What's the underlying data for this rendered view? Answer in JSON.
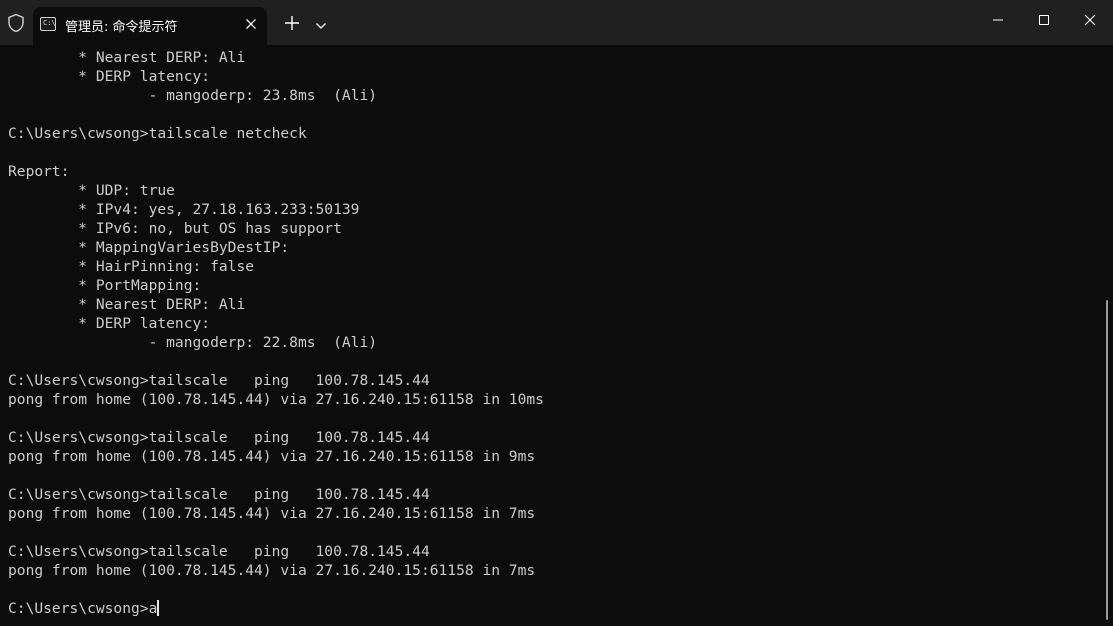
{
  "tab": {
    "title": "管理员: 命令提示符",
    "icon": "cmd-icon"
  },
  "titlebar": {
    "icons": [
      "shield-icon",
      "close-icon",
      "plus-icon",
      "chevron-down-icon",
      "minimize-icon",
      "maximize-icon",
      "close-icon"
    ]
  },
  "terminal": {
    "lines": [
      "        * Nearest DERP: Ali",
      "        * DERP latency:",
      "                - mangoderp: 23.8ms  (Ali)",
      "",
      "C:\\Users\\cwsong>tailscale netcheck",
      "",
      "Report:",
      "        * UDP: true",
      "        * IPv4: yes, 27.18.163.233:50139",
      "        * IPv6: no, but OS has support",
      "        * MappingVariesByDestIP:",
      "        * HairPinning: false",
      "        * PortMapping:",
      "        * Nearest DERP: Ali",
      "        * DERP latency:",
      "                - mangoderp: 22.8ms  (Ali)",
      "",
      "C:\\Users\\cwsong>tailscale   ping   100.78.145.44",
      "pong from home (100.78.145.44) via 27.16.240.15:61158 in 10ms",
      "",
      "C:\\Users\\cwsong>tailscale   ping   100.78.145.44",
      "pong from home (100.78.145.44) via 27.16.240.15:61158 in 9ms",
      "",
      "C:\\Users\\cwsong>tailscale   ping   100.78.145.44",
      "pong from home (100.78.145.44) via 27.16.240.15:61158 in 7ms",
      "",
      "C:\\Users\\cwsong>tailscale   ping   100.78.145.44",
      "pong from home (100.78.145.44) via 27.16.240.15:61158 in 7ms",
      ""
    ],
    "prompt": "C:\\Users\\cwsong>a"
  },
  "colors": {
    "background": "#0c0c0c",
    "titlebar": "#202020",
    "text": "#cccccc"
  }
}
